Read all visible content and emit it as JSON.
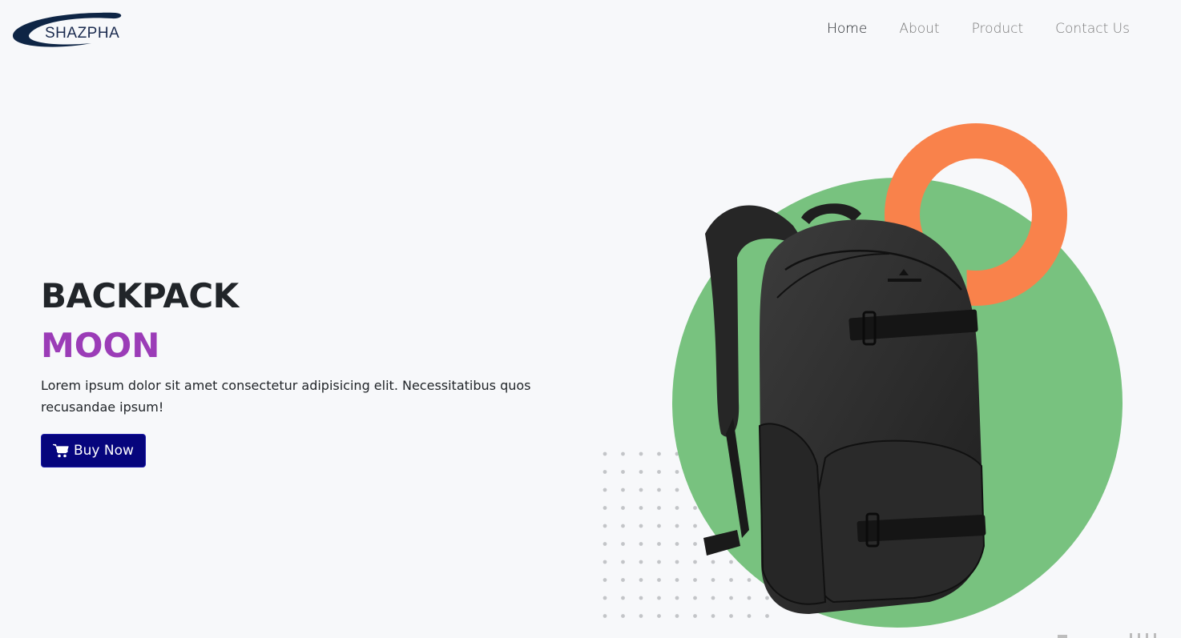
{
  "brand": {
    "name": "SHAZPHA"
  },
  "nav": {
    "items": [
      {
        "label": "Home",
        "active": true
      },
      {
        "label": "About",
        "active": false
      },
      {
        "label": "Product",
        "active": false
      },
      {
        "label": "Contact Us",
        "active": false
      }
    ]
  },
  "hero": {
    "title": "BACKPACK",
    "subtitle": "MOON",
    "description": "Lorem ipsum dolor sit amet consectetur adipisicing elit. Necessitatibus quos recusandae ipsum!",
    "button_label": "Buy Now",
    "button_icon": "cart-icon"
  },
  "colors": {
    "background": "#f7f8fa",
    "accent_purple": "#9b3cb7",
    "button_navy": "#06057d",
    "circle_green": "#78c27f",
    "ring_orange": "#f9824b"
  }
}
